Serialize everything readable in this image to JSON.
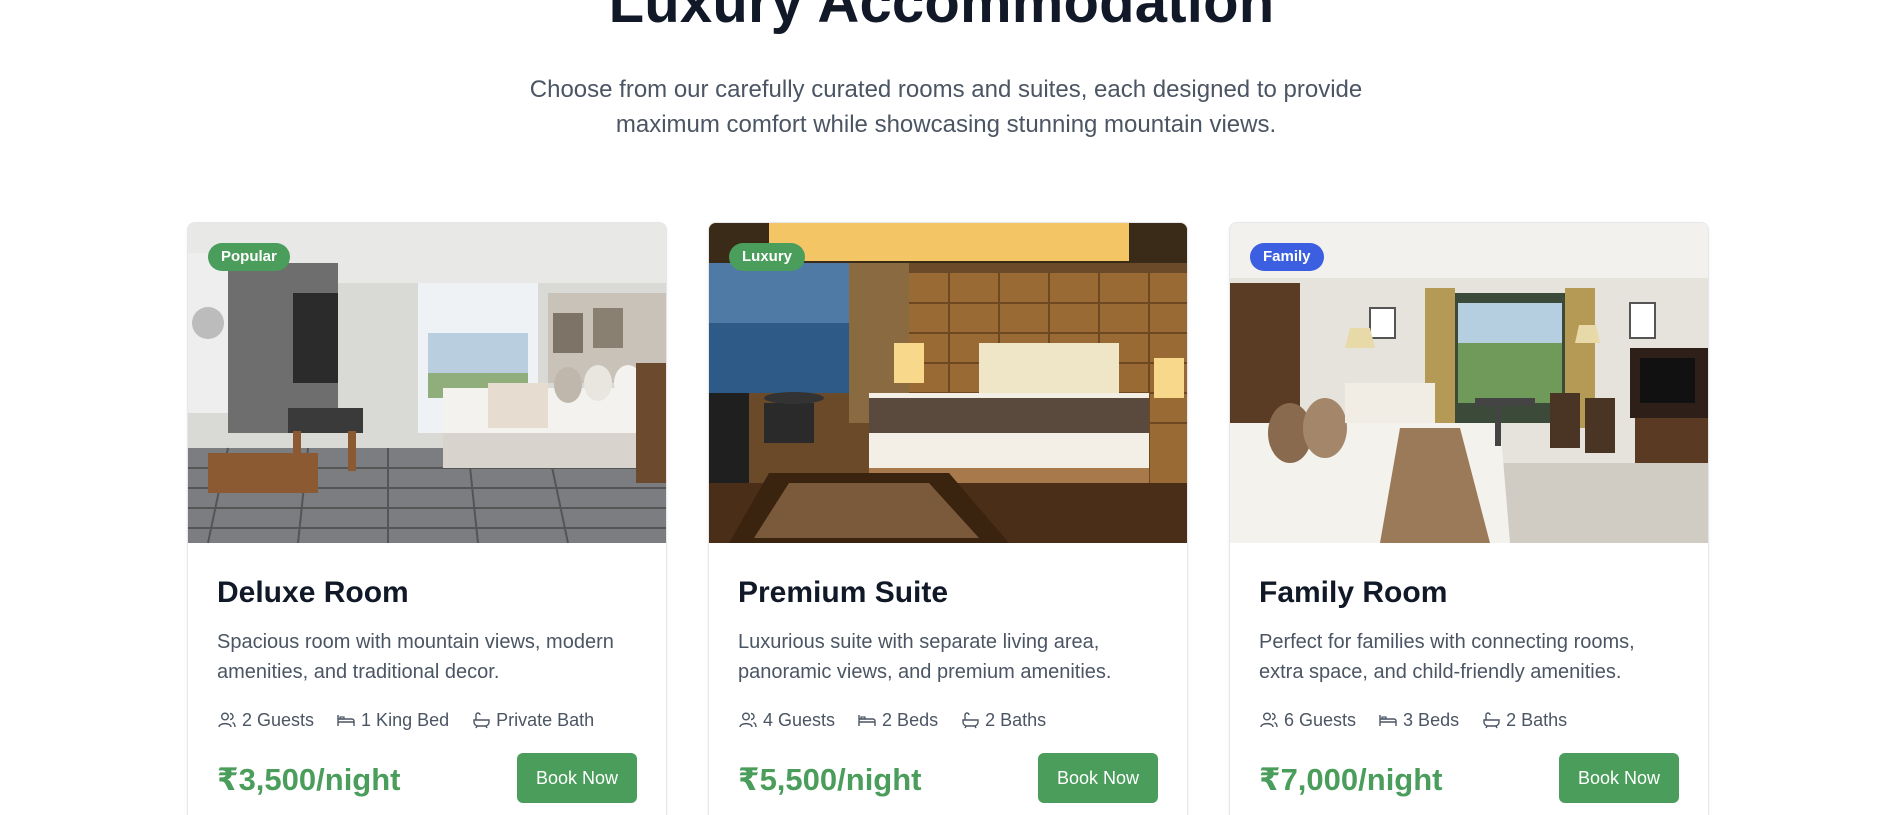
{
  "section": {
    "title": "Luxury Accommodation",
    "subtitle": "Choose from our carefully curated rooms and suites, each designed to provide maximum comfort while showcasing stunning mountain views."
  },
  "colors": {
    "accent_green": "#4a9d5b",
    "badge_green": "#4a9d5b",
    "badge_blue": "#3b5fe0",
    "heading": "#111827",
    "muted_text": "#4b5563"
  },
  "rooms": [
    {
      "badge": "Popular",
      "badge_color": "#4a9d5b",
      "title": "Deluxe Room",
      "description": "Spacious room with mountain views, modern amenities, and traditional decor.",
      "features": [
        {
          "icon": "guests-icon",
          "label": "2 Guests"
        },
        {
          "icon": "bed-icon",
          "label": "1 King Bed"
        },
        {
          "icon": "bath-icon",
          "label": "Private Bath"
        }
      ],
      "price": "₹3,500/night",
      "button_label": "Book Now"
    },
    {
      "badge": "Luxury",
      "badge_color": "#4a9d5b",
      "title": "Premium Suite",
      "description": "Luxurious suite with separate living area, panoramic views, and premium amenities.",
      "features": [
        {
          "icon": "guests-icon",
          "label": "4 Guests"
        },
        {
          "icon": "bed-icon",
          "label": "2 Beds"
        },
        {
          "icon": "bath-icon",
          "label": "2 Baths"
        }
      ],
      "price": "₹5,500/night",
      "button_label": "Book Now"
    },
    {
      "badge": "Family",
      "badge_color": "#3b5fe0",
      "title": "Family Room",
      "description": "Perfect for families with connecting rooms, extra space, and child-friendly amenities.",
      "features": [
        {
          "icon": "guests-icon",
          "label": "6 Guests"
        },
        {
          "icon": "bed-icon",
          "label": "3 Beds"
        },
        {
          "icon": "bath-icon",
          "label": "2 Baths"
        }
      ],
      "price": "₹7,000/night",
      "button_label": "Book Now"
    }
  ]
}
